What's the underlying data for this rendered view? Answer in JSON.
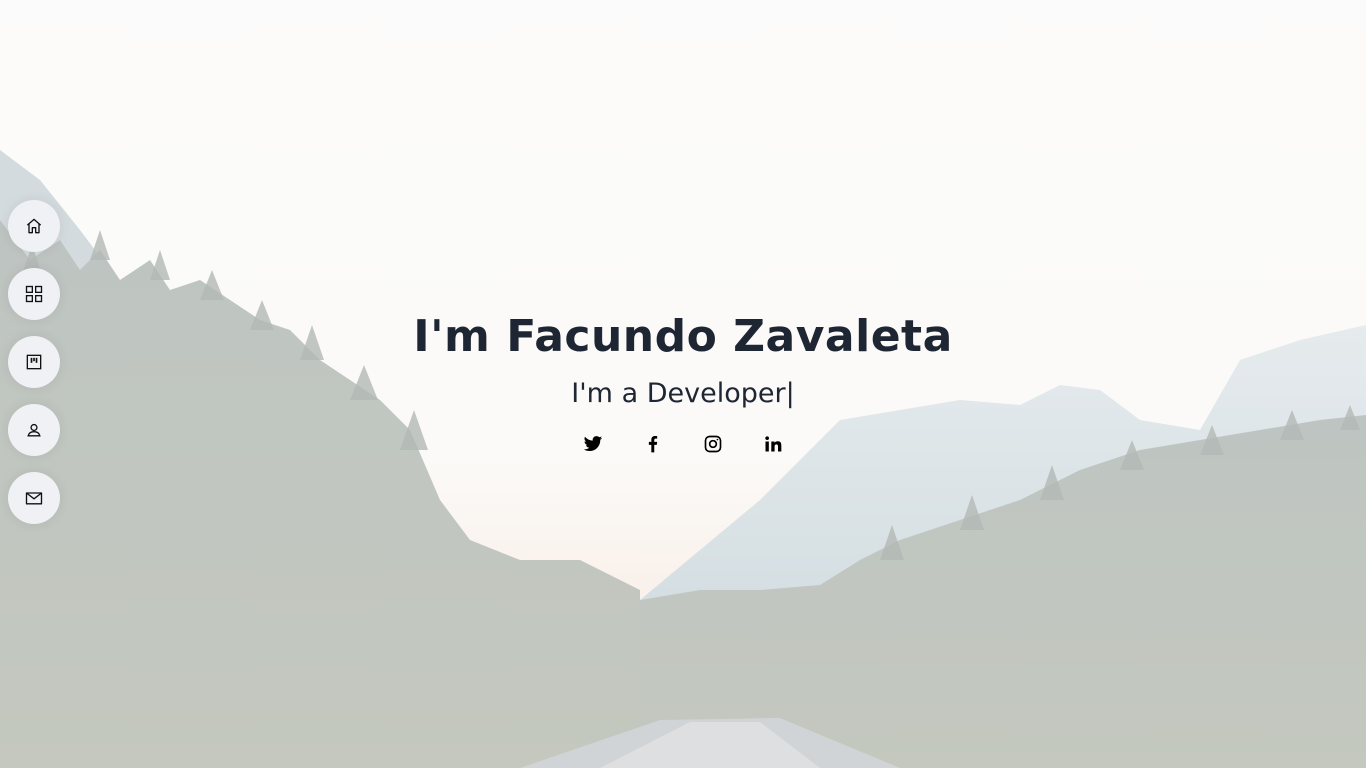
{
  "hero": {
    "title": "I'm Facundo Zavaleta",
    "subtitle_prefix": "I'm a ",
    "subtitle_role": "Developer",
    "cursor": "|"
  },
  "nav": {
    "items": [
      {
        "name": "home",
        "icon": "home-icon"
      },
      {
        "name": "grid",
        "icon": "grid-icon"
      },
      {
        "name": "kanban",
        "icon": "kanban-icon"
      },
      {
        "name": "user",
        "icon": "user-icon"
      },
      {
        "name": "mail",
        "icon": "mail-icon"
      }
    ]
  },
  "social": {
    "items": [
      {
        "name": "twitter",
        "icon": "twitter-icon"
      },
      {
        "name": "facebook",
        "icon": "facebook-icon"
      },
      {
        "name": "instagram",
        "icon": "instagram-icon"
      },
      {
        "name": "linkedin",
        "icon": "linkedin-icon"
      }
    ]
  },
  "colors": {
    "text": "#1e2633",
    "nav_bg": "#eff1f4",
    "sky": "#f9f7f4",
    "forest": "#5e6b63",
    "mountain": "#a9bcc4"
  }
}
